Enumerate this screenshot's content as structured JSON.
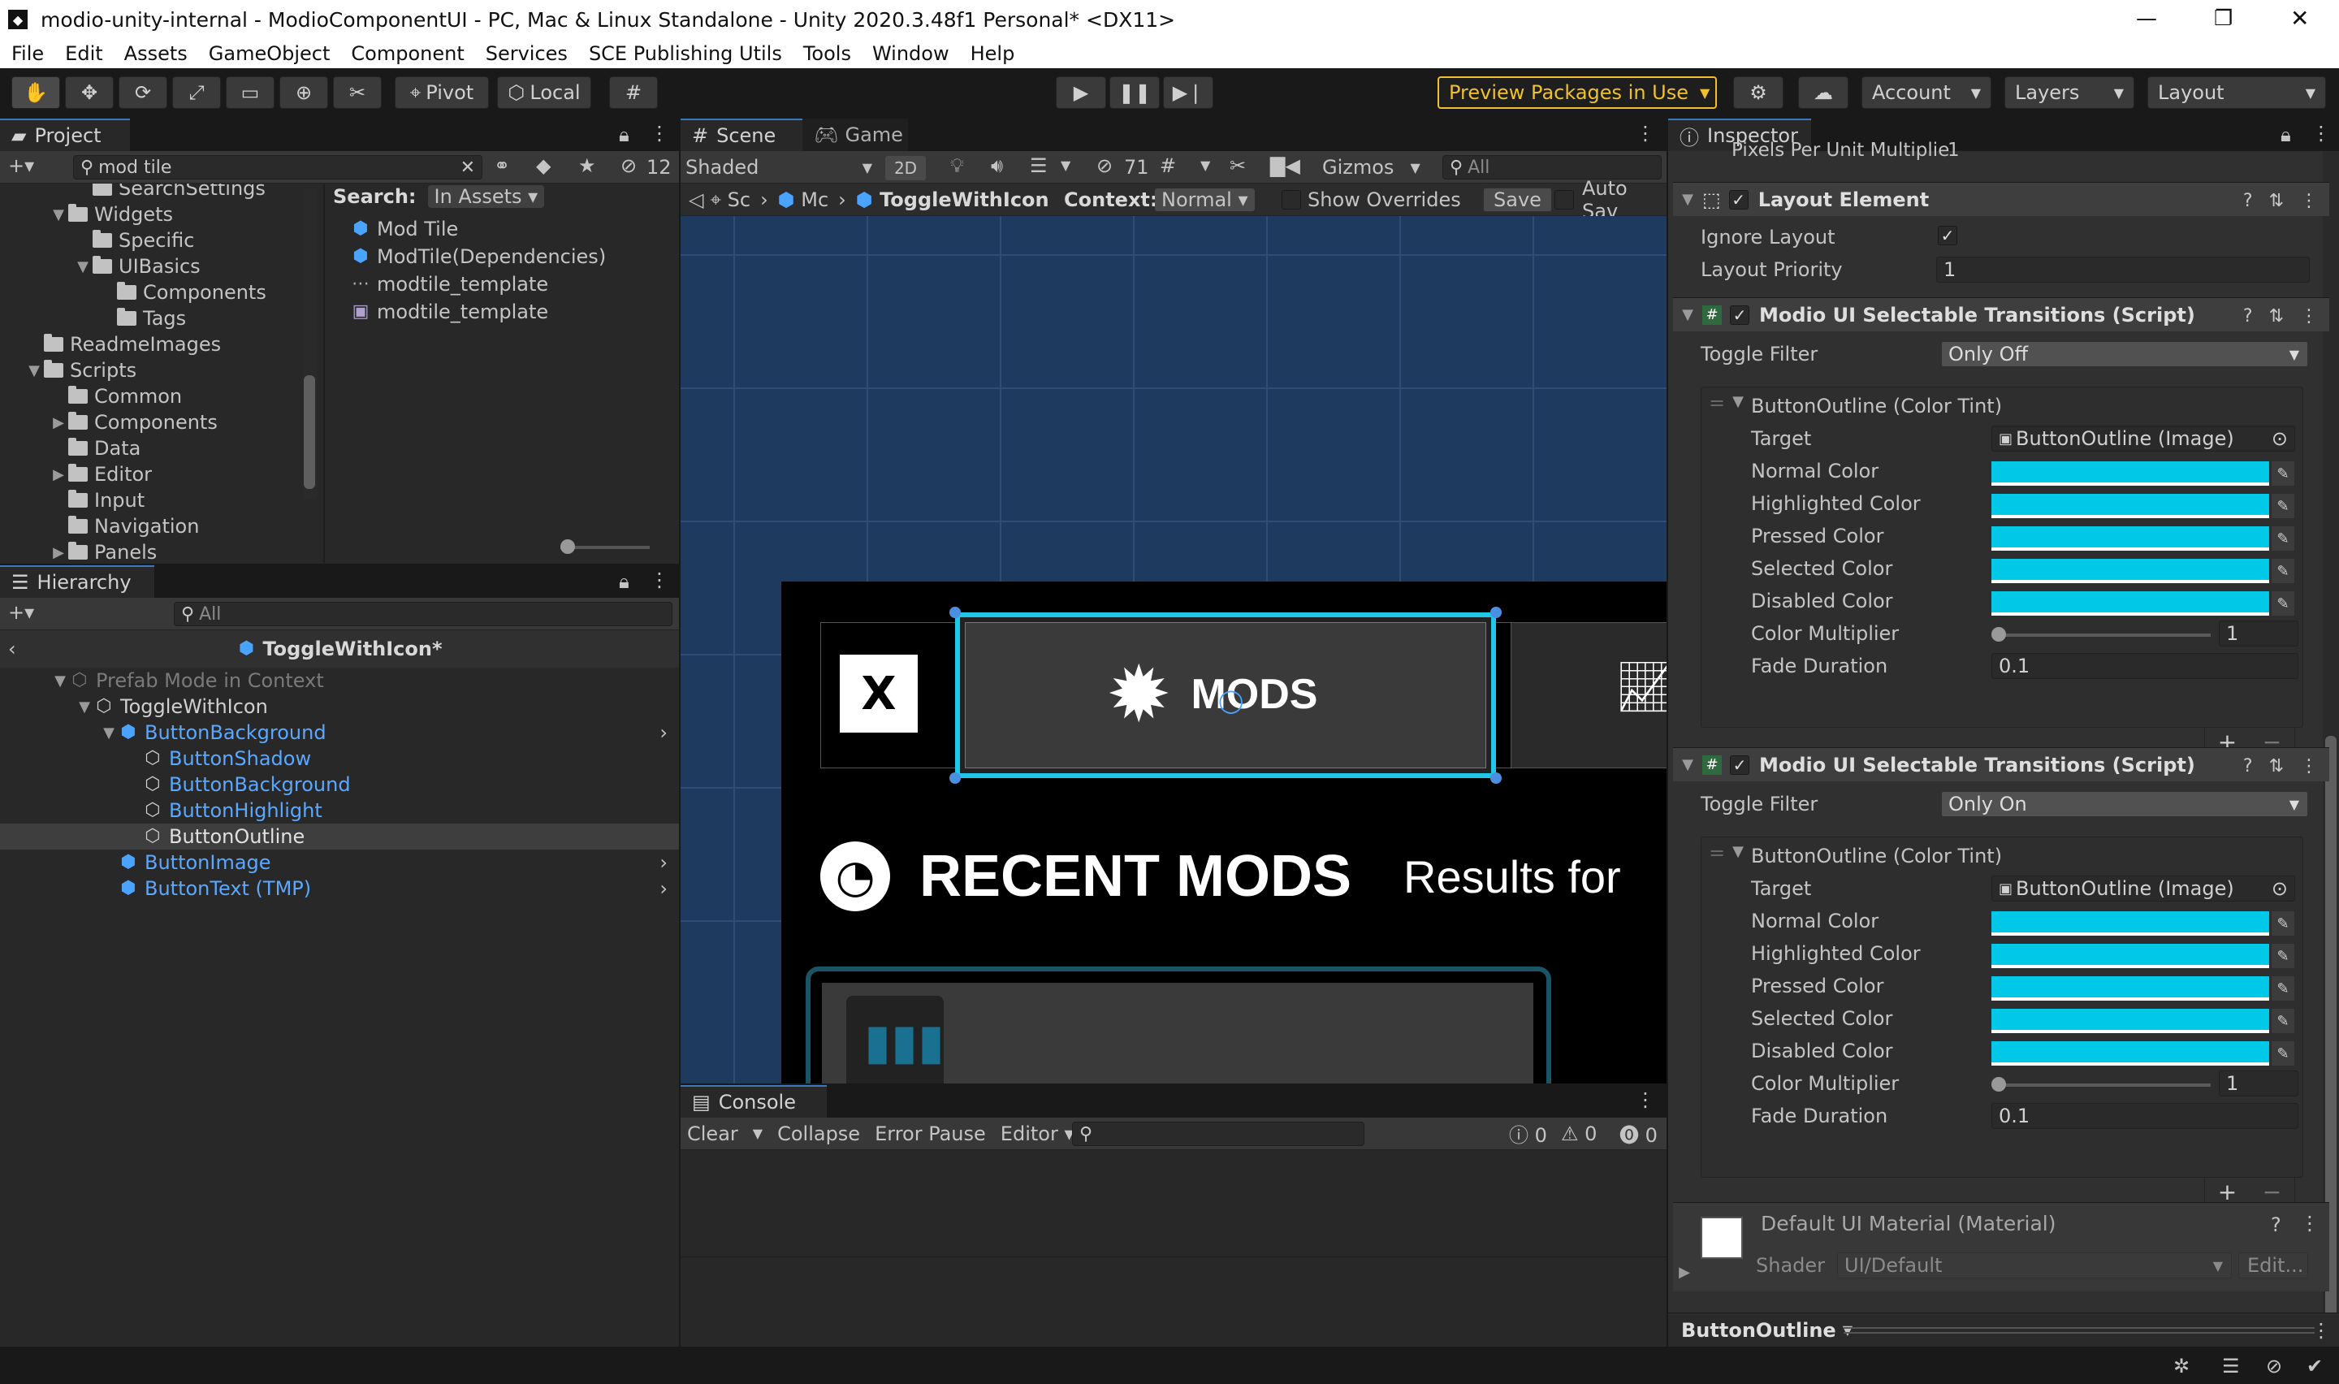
{
  "window": {
    "title": "modio-unity-internal - ModioComponentUI - PC, Mac & Linux Standalone - Unity 2020.3.48f1 Personal* <DX11>",
    "controls": [
      "—",
      "❐",
      "✕"
    ]
  },
  "menu": [
    "File",
    "Edit",
    "Assets",
    "GameObject",
    "Component",
    "Services",
    "SCE Publishing Utils",
    "Tools",
    "Window",
    "Help"
  ],
  "toolbar": {
    "pivot": "Pivot",
    "local": "Local",
    "preview_packages": "Preview Packages in Use",
    "account": "Account",
    "layers": "Layers",
    "layout": "Layout"
  },
  "project": {
    "tab": "Project",
    "search_value": "mod tile",
    "hidden_count": "12",
    "search_label": "Search:",
    "search_scope": "In Assets",
    "tree": [
      {
        "label": "SearchSettings",
        "indent": 3,
        "arrow": ""
      },
      {
        "label": "Widgets",
        "indent": 2,
        "arrow": "▼"
      },
      {
        "label": "Specific",
        "indent": 3,
        "arrow": ""
      },
      {
        "label": "UIBasics",
        "indent": 3,
        "arrow": "▼"
      },
      {
        "label": "Components",
        "indent": 4,
        "arrow": ""
      },
      {
        "label": "Tags",
        "indent": 4,
        "arrow": ""
      },
      {
        "label": "ReadmeImages",
        "indent": 1,
        "arrow": ""
      },
      {
        "label": "Scripts",
        "indent": 1,
        "arrow": "▼"
      },
      {
        "label": "Common",
        "indent": 2,
        "arrow": ""
      },
      {
        "label": "Components",
        "indent": 2,
        "arrow": "▶"
      },
      {
        "label": "Data",
        "indent": 2,
        "arrow": ""
      },
      {
        "label": "Editor",
        "indent": 2,
        "arrow": "▶"
      },
      {
        "label": "Input",
        "indent": 2,
        "arrow": ""
      },
      {
        "label": "Navigation",
        "indent": 2,
        "arrow": ""
      },
      {
        "label": "Panels",
        "indent": 2,
        "arrow": "▶"
      }
    ],
    "results": [
      {
        "label": "Mod Tile",
        "icon": "prefab"
      },
      {
        "label": "ModTile(Dependencies)",
        "icon": "prefab"
      },
      {
        "label": "modtile_template",
        "icon": "asset"
      },
      {
        "label": "modtile_template",
        "icon": "sprite"
      }
    ]
  },
  "hierarchy": {
    "tab": "Hierarchy",
    "search_placeholder": "All",
    "prefab_title": "ToggleWithIcon*",
    "items": [
      {
        "label": "Prefab Mode in Context",
        "indent": 0,
        "style": "muted",
        "arrow": "▼",
        "chevron": false
      },
      {
        "label": "ToggleWithIcon",
        "indent": 1,
        "style": "normal",
        "arrow": "▼",
        "chevron": false
      },
      {
        "label": "ButtonBackground",
        "indent": 2,
        "style": "blue",
        "arrow": "▼",
        "chevron": true
      },
      {
        "label": "ButtonShadow",
        "indent": 3,
        "style": "blue",
        "arrow": "",
        "chevron": false
      },
      {
        "label": "ButtonBackground",
        "indent": 3,
        "style": "blue",
        "arrow": "",
        "chevron": false
      },
      {
        "label": "ButtonHighlight",
        "indent": 3,
        "style": "blue",
        "arrow": "",
        "chevron": false
      },
      {
        "label": "ButtonOutline",
        "indent": 3,
        "style": "selected",
        "arrow": "",
        "chevron": false
      },
      {
        "label": "ButtonImage",
        "indent": 2,
        "style": "blue",
        "arrow": "",
        "chevron": true
      },
      {
        "label": "ButtonText (TMP)",
        "indent": 2,
        "style": "blue",
        "arrow": "",
        "chevron": true
      }
    ]
  },
  "scene": {
    "tab_scene": "Scene",
    "tab_game": "Game",
    "shading": "Shaded",
    "mode_2d": "2D",
    "hidden_count": "71",
    "gizmos": "Gizmos",
    "search_placeholder": "All",
    "breadcrumb": [
      "Sc",
      "Mc",
      "ToggleWithIcon"
    ],
    "context_label": "Context:",
    "context_value": "Normal",
    "show_overrides": "Show Overrides",
    "save": "Save",
    "auto_save": "Auto Sav",
    "canvas": {
      "close_glyph": "X",
      "mods_label": "MODS",
      "recent_mods": "RECENT MODS",
      "results_for": "Results for"
    }
  },
  "console": {
    "tab": "Console",
    "clear": "Clear",
    "collapse": "Collapse",
    "error_pause": "Error Pause",
    "editor": "Editor",
    "counts": {
      "errors_info": "0",
      "warnings": "0",
      "errors": "0"
    }
  },
  "inspector": {
    "tab": "Inspector",
    "top_cut_label": "Pixels Per Unit Multiplie",
    "top_cut_value": "1",
    "layout_element": {
      "title": "Layout Element",
      "ignore_layout_label": "Ignore Layout",
      "layout_priority_label": "Layout Priority",
      "layout_priority_value": "1"
    },
    "transitions": [
      {
        "title": "Modio UI Selectable Transitions (Script)",
        "toggle_filter_label": "Toggle Filter",
        "toggle_filter_value": "Only Off",
        "group_title": "ButtonOutline (Color Tint)",
        "target_label": "Target",
        "target_value": "ButtonOutline (Image)",
        "color_labels": [
          "Normal Color",
          "Highlighted Color",
          "Pressed Color",
          "Selected Color",
          "Disabled Color"
        ],
        "color_multiplier_label": "Color Multiplier",
        "color_multiplier_value": "1",
        "fade_duration_label": "Fade Duration",
        "fade_duration_value": "0.1"
      },
      {
        "title": "Modio UI Selectable Transitions (Script)",
        "toggle_filter_label": "Toggle Filter",
        "toggle_filter_value": "Only On",
        "group_title": "ButtonOutline (Color Tint)",
        "target_label": "Target",
        "target_value": "ButtonOutline (Image)",
        "color_labels": [
          "Normal Color",
          "Highlighted Color",
          "Pressed Color",
          "Selected Color",
          "Disabled Color"
        ],
        "color_multiplier_label": "Color Multiplier",
        "color_multiplier_value": "1",
        "fade_duration_label": "Fade Duration",
        "fade_duration_value": "0.1"
      }
    ],
    "material": {
      "title": "Default UI Material (Material)",
      "shader_label": "Shader",
      "shader_value": "UI/Default",
      "edit": "Edit..."
    },
    "footer_object": "ButtonOutline"
  },
  "colors": {
    "tint": "#00c8e6",
    "selection_outline": "#1ec8e6",
    "scene_bg": "#1f3a5f",
    "accent_blue": "#4aa3ff",
    "preview_packages": "#f0c030"
  }
}
